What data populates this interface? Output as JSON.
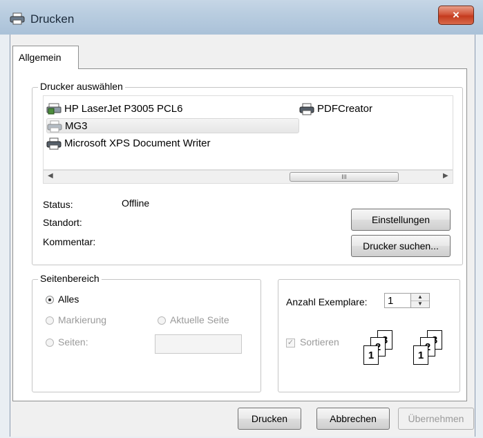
{
  "window": {
    "title": "Drucken",
    "close_label": "×"
  },
  "tabs": [
    {
      "label": "Allgemein"
    }
  ],
  "printer_group": {
    "legend": "Drucker auswählen",
    "printers": [
      {
        "name": "HP LaserJet P3005 PCL6",
        "icon": "network-printer-icon"
      },
      {
        "name": "PDFCreator",
        "icon": "printer-icon"
      },
      {
        "name": "MG3",
        "icon": "printer-icon"
      },
      {
        "name": "Microsoft XPS Document Writer",
        "icon": "printer-icon"
      }
    ],
    "selected": "MG3",
    "scroll_thumb": "III"
  },
  "status": {
    "status_label": "Status:",
    "status_value": "Offline",
    "location_label": "Standort:",
    "comment_label": "Kommentar:"
  },
  "buttons": {
    "settings": "Einstellungen",
    "find_printer": "Drucker suchen...",
    "print": "Drucken",
    "cancel": "Abbrechen",
    "apply": "Übernehmen"
  },
  "page_range": {
    "legend": "Seitenbereich",
    "all": "Alles",
    "selection": "Markierung",
    "current_page": "Aktuelle Seite",
    "pages": "Seiten:",
    "pages_value": ""
  },
  "copies": {
    "label": "Anzahl Exemplare:",
    "value": "1",
    "collate_label": "Sortieren",
    "collate_checked": true,
    "page_numbers": [
      "1",
      "2",
      "3"
    ]
  }
}
